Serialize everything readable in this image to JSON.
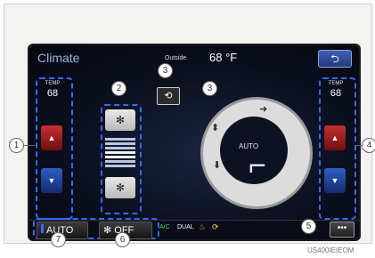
{
  "header": {
    "title": "Climate",
    "outside_label": "Outside",
    "outside_temp": "68 °F",
    "back_icon": "back-arrow-icon"
  },
  "left_temp": {
    "label": "TEMP",
    "value": "68"
  },
  "right_temp": {
    "label": "TEMP",
    "value": "68"
  },
  "fan": {
    "up_icon": "fan-high-icon",
    "down_icon": "fan-low-icon",
    "level": 0.5
  },
  "mode": {
    "center_label": "AUTO"
  },
  "bottom": {
    "auto_label": "AUTO",
    "fan_off_label": "OFF",
    "ac_label": "A/C",
    "dual_label": "DUAL",
    "more_label": "•••"
  },
  "callouts": {
    "c1": "1",
    "c2": "2",
    "c3a": "3",
    "c3b": "3",
    "c4": "4",
    "c5": "5",
    "c6": "6",
    "c7": "7"
  },
  "image_code": "US400IEIEOM",
  "colors": {
    "accent_blue": "#2f6bff",
    "temp_up": "#c63030",
    "temp_down": "#2f5ec4",
    "title": "#9db5e6"
  }
}
